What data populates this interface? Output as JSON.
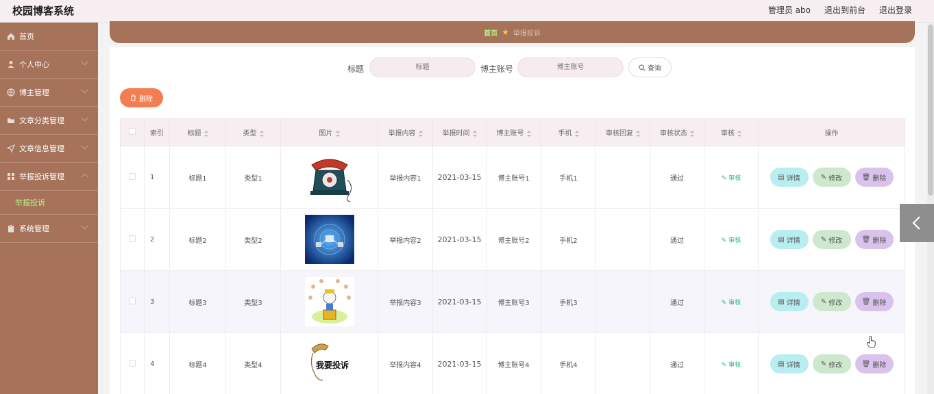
{
  "app": {
    "title": "校园博客系统"
  },
  "header": {
    "admin": "管理员 abo",
    "front": "退出到前台",
    "logout": "退出登录"
  },
  "sidebar": {
    "items": [
      {
        "label": "首页"
      },
      {
        "label": "个人中心"
      },
      {
        "label": "博主管理"
      },
      {
        "label": "文章分类管理"
      },
      {
        "label": "文章信息管理"
      },
      {
        "label": "举报投诉管理"
      },
      {
        "label": "系统管理"
      }
    ],
    "subitem": "举报投诉"
  },
  "breadcrumb": {
    "home": "首页",
    "current": "举报投诉"
  },
  "search": {
    "title_label": "标题",
    "title_placeholder": "标题",
    "account_label": "博主账号",
    "account_placeholder": "博主账号",
    "query_button": "查询"
  },
  "actions": {
    "delete": "删除"
  },
  "table": {
    "headers": [
      "索引",
      "标题",
      "类型",
      "图片",
      "举报内容",
      "举报时间",
      "博主账号",
      "手机",
      "审核回复",
      "审核状态",
      "审核",
      "操作"
    ],
    "audit_label": "审核",
    "op_labels": {
      "detail": "详情",
      "edit": "修改",
      "delete": "删除"
    },
    "rows": [
      {
        "index": "1",
        "title": "标题1",
        "type": "类型1",
        "content": "举报内容1",
        "time": "2021-03-15",
        "account": "博主账号1",
        "phone": "手机1",
        "reply": "",
        "status": "通过"
      },
      {
        "index": "2",
        "title": "标题2",
        "type": "类型2",
        "content": "举报内容2",
        "time": "2021-03-15",
        "account": "博主账号2",
        "phone": "手机2",
        "reply": "",
        "status": "通过"
      },
      {
        "index": "3",
        "title": "标题3",
        "type": "类型3",
        "content": "举报内容3",
        "time": "2021-03-15",
        "account": "博主账号3",
        "phone": "手机3",
        "reply": "",
        "status": "通过"
      },
      {
        "index": "4",
        "title": "标题4",
        "type": "类型4",
        "content": "举报内容4",
        "time": "2021-03-15",
        "account": "博主账号4",
        "phone": "手机4",
        "reply": "",
        "status": "通过"
      }
    ]
  },
  "images": {
    "row1": {
      "alt": "telephone-image"
    },
    "row2": {
      "alt": "network-image"
    },
    "row3": {
      "alt": "complaint-cartoon-image"
    },
    "row4": {
      "banner": "我要投诉"
    }
  },
  "colors": {
    "sidebar": "#a6725a",
    "accent": "#b4f08a",
    "delete": "#f27e52",
    "header": "#f7eef1"
  }
}
